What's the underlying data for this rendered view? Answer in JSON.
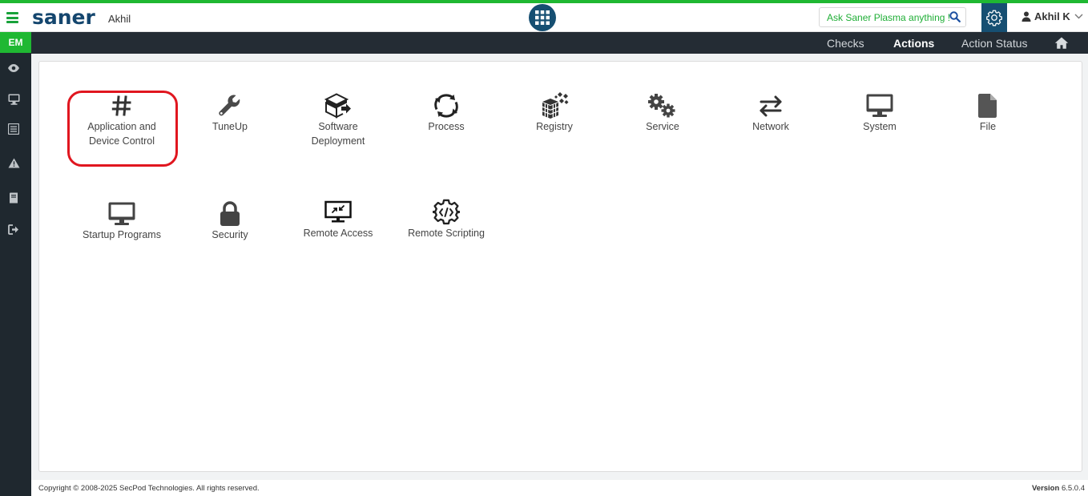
{
  "header": {
    "logo": "saner",
    "org_name": "Akhil",
    "ask_placeholder": "Ask Saner Plasma anything !",
    "user_name": "Akhil K"
  },
  "nav": {
    "items": [
      "Checks",
      "Actions",
      "Action Status"
    ],
    "active": "Actions"
  },
  "sidebar": {
    "module": "EM",
    "icons": [
      "eye-icon",
      "monitor-icon",
      "list-icon",
      "warning-icon",
      "book-icon",
      "logout-icon"
    ]
  },
  "actions": [
    {
      "label": "Application and\nDevice Control",
      "icon": "hash-icon"
    },
    {
      "label": "TuneUp",
      "icon": "wrench-icon"
    },
    {
      "label": "Software\nDeployment",
      "icon": "software-deploy-icon"
    },
    {
      "label": "Process",
      "icon": "process-icon"
    },
    {
      "label": "Registry",
      "icon": "registry-icon"
    },
    {
      "label": "Service",
      "icon": "gears-icon"
    },
    {
      "label": "Network",
      "icon": "network-icon"
    },
    {
      "label": "System",
      "icon": "system-monitor-icon"
    },
    {
      "label": "File",
      "icon": "file-icon"
    },
    {
      "label": "Startup Programs",
      "icon": "startup-monitor-icon"
    },
    {
      "label": "Security",
      "icon": "lock-icon"
    },
    {
      "label": "Remote Access",
      "icon": "remote-access-icon"
    },
    {
      "label": "Remote Scripting",
      "icon": "remote-scripting-icon"
    }
  ],
  "footer": {
    "copyright": "Copyright © 2008-2025 SecPod Technologies. All rights reserved.",
    "version_label": "Version",
    "version_number": "6.5.0.4"
  },
  "colors": {
    "brand_green": "#1fb832",
    "brand_navy": "#164f72",
    "nav_dark": "#242c34",
    "highlight_red": "#e0161f"
  }
}
